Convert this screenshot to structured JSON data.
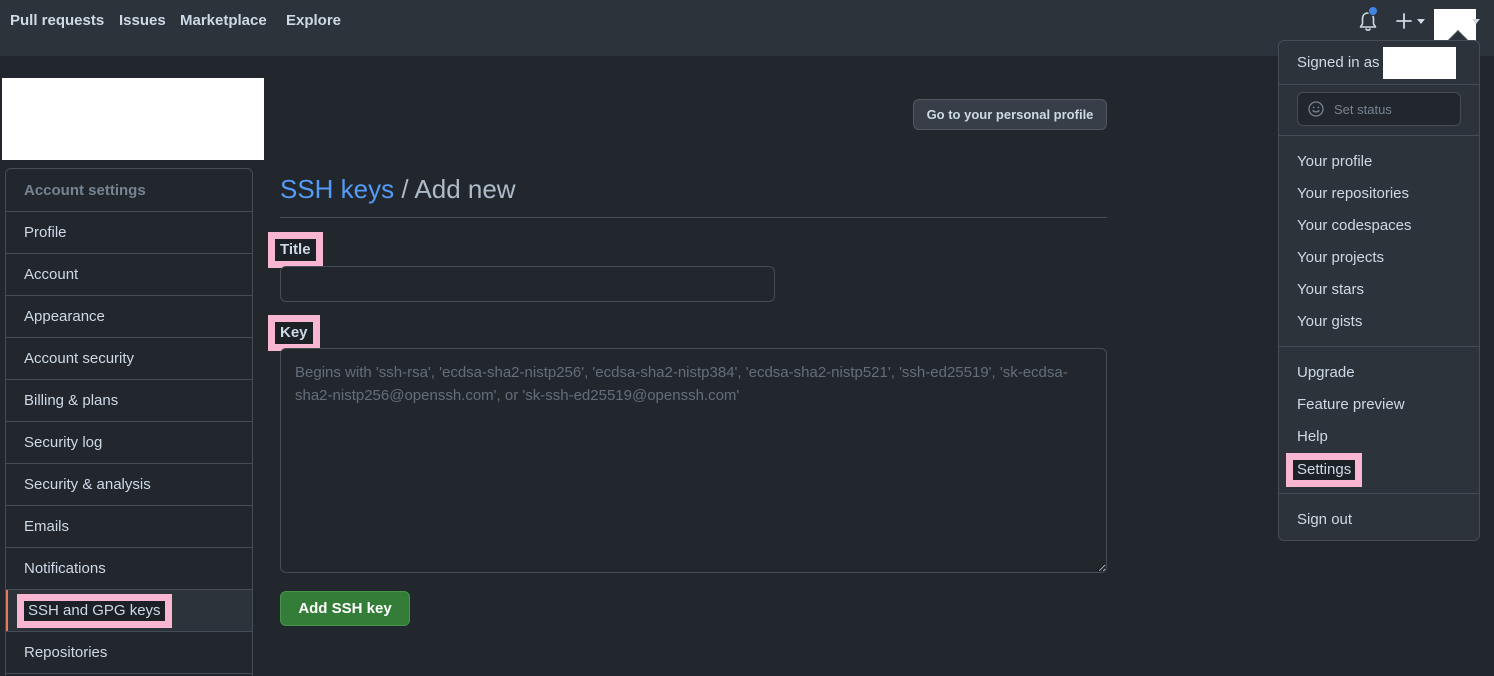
{
  "nav": {
    "pull_requests": "Pull requests",
    "issues": "Issues",
    "marketplace": "Marketplace",
    "explore": "Explore"
  },
  "icons": {
    "bell": "bell-icon",
    "plus": "plus-icon",
    "caret": "chevron-down-icon",
    "smiley": "smiley-icon"
  },
  "colors": {
    "background": "#22272e",
    "header": "#2d333b",
    "link": "#539bf5",
    "primary_button": "#347d39",
    "highlight": "#f9b6d2",
    "notification_dot": "#4184e4"
  },
  "sidebar": {
    "heading": "Account settings",
    "items": [
      {
        "label": "Profile"
      },
      {
        "label": "Account"
      },
      {
        "label": "Appearance"
      },
      {
        "label": "Account security"
      },
      {
        "label": "Billing & plans"
      },
      {
        "label": "Security log"
      },
      {
        "label": "Security & analysis"
      },
      {
        "label": "Emails"
      },
      {
        "label": "Notifications"
      },
      {
        "label": "SSH and GPG keys"
      },
      {
        "label": "Repositories"
      }
    ]
  },
  "main": {
    "profile_button": "Go to your personal profile",
    "breadcrumb": "SSH keys",
    "separator": " / ",
    "title": "Add new",
    "title_label": "Title",
    "title_value": "",
    "key_label": "Key",
    "key_placeholder": "Begins with 'ssh-rsa', 'ecdsa-sha2-nistp256', 'ecdsa-sha2-nistp384', 'ecdsa-sha2-nistp521', 'ssh-ed25519', 'sk-ecdsa-sha2-nistp256@openssh.com', or 'sk-ssh-ed25519@openssh.com'",
    "submit_label": "Add SSH key"
  },
  "dropdown": {
    "signed_in_label": "Signed in as",
    "set_status": "Set status",
    "profile": "Your profile",
    "repositories": "Your repositories",
    "codespaces": "Your codespaces",
    "projects": "Your projects",
    "stars": "Your stars",
    "gists": "Your gists",
    "upgrade": "Upgrade",
    "feature_preview": "Feature preview",
    "help": "Help",
    "settings": "Settings",
    "sign_out": "Sign out"
  }
}
